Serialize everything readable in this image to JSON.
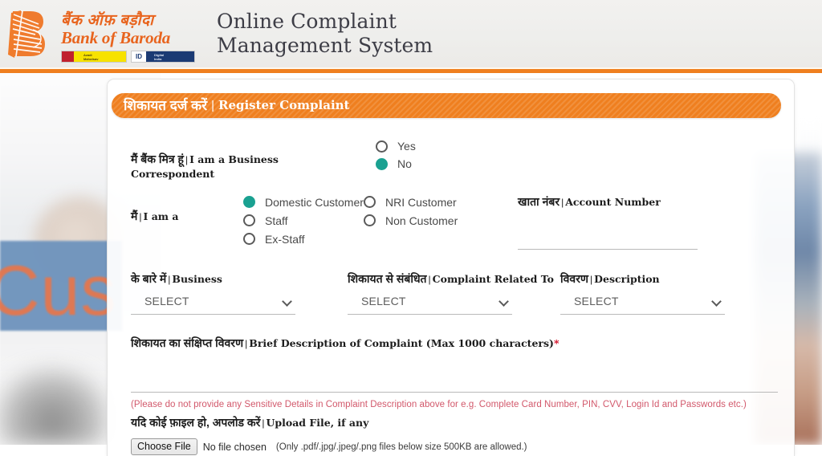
{
  "header": {
    "logo": {
      "hindi_name": "बैंक ऑफ़ बड़ौदा",
      "english_name": "Bank of Baroda",
      "badge_azadi": "Azadi Ka Amrit Mahotsav",
      "badge_digital": "Digital India"
    },
    "title_line1": "Online Complaint",
    "title_line2": "Management System"
  },
  "card": {
    "title_hindi": "शिकायत दर्ज करें",
    "title_separator": "|",
    "title_english": "Register Complaint"
  },
  "business_correspondent": {
    "label_hindi": "मैं बैंक मित्र हूं",
    "label_separator": "|",
    "label_english": "I am a Business Correspondent",
    "options": [
      {
        "label": "Yes",
        "checked": false
      },
      {
        "label": "No",
        "checked": true
      }
    ]
  },
  "i_am_a": {
    "label_hindi": "मैं",
    "label_separator": "|",
    "label_english": "I am a",
    "column1": [
      {
        "label": "Domestic Customer",
        "checked": true
      },
      {
        "label": "Staff",
        "checked": false
      },
      {
        "label": "Ex-Staff",
        "checked": false
      }
    ],
    "column2": [
      {
        "label": "NRI Customer",
        "checked": false
      },
      {
        "label": "Non Customer",
        "checked": false
      }
    ]
  },
  "account_number": {
    "label_hindi": "खाता नंबर",
    "label_separator": "|",
    "label_english": "Account Number",
    "value": ""
  },
  "selects": [
    {
      "label_hindi": "के बारे में",
      "label_separator": "|",
      "label_english": "Business",
      "value": "SELECT"
    },
    {
      "label_hindi": "शिकायत से संबंधित",
      "label_separator": "|",
      "label_english": "Complaint Related To",
      "value": "SELECT"
    },
    {
      "label_hindi": "विवरण",
      "label_separator": "|",
      "label_english": "Description",
      "value": "SELECT"
    }
  ],
  "brief_description": {
    "label_hindi": "शिकायत का संक्षिप्त विवरण",
    "label_separator": "|",
    "label_english": "Brief Description of Complaint (Max 1000 characters)",
    "required_marker": "*",
    "value": ""
  },
  "warning_text": "(Please do not provide any Sensitive Details in Complaint Description above for e.g. Complete Card Number, PIN, CVV, Login Id and Passwords etc.)",
  "upload": {
    "label_hindi": "यदि कोई फ़ाइल हो, अपलोड करें",
    "label_separator": "|",
    "label_english": "Upload File, if any",
    "button_label": "Choose File",
    "file_status": "No file chosen",
    "hint": "(Only .pdf/.jpg/.jpeg/.png files below size 500KB are allowed.)"
  },
  "background": {
    "banner_word": "Cus"
  }
}
